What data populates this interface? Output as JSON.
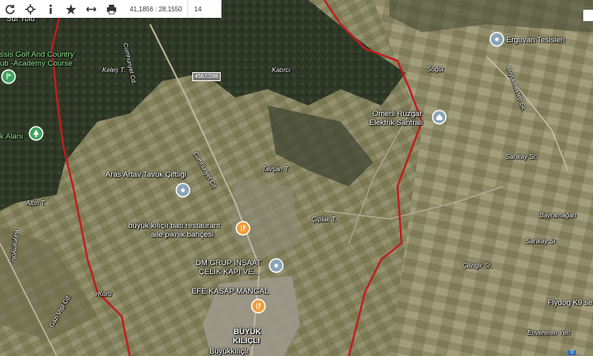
{
  "toolbar": {
    "coords": "41,1856 : 28,1550",
    "zoom": "14"
  },
  "places": {
    "sut_yolu": "Sut Yolu",
    "golf1": "ssis Golf And Country",
    "golf2": "ub -Academy Course",
    "keles": "Keleş T.",
    "road_4567": "4567/298",
    "katirci": "Katırcı",
    "sogut": "Söğüt",
    "erguvan": "Erguvan Tesisleri",
    "omerli1": "Ömerli Rüzgar",
    "omerli2": "Elektrik Santrali",
    "k_alani": "k Alanı",
    "aras": "Aras Artav Tavuk Çiftliği",
    "altin": "Altın T.",
    "tavsan": "Tavşan T.",
    "ciplak": "Çıplak T.",
    "sarikaya": "Sarıkay Sr.",
    "bayramagan": "Bayramağan",
    "sarikaya2": "Sarıkay Sr.",
    "rest1": "büyük kılıçlı batı restaurant",
    "rest2": "aile piknik bahçesi",
    "dm1": "DM GRUP İNŞAAT",
    "dm2": "ÇELİK KAPI VE...",
    "efe": "EFE KASAP MANGAL",
    "cilingir": "Çilingir Sr.",
    "flydog": "Flydog K9 se",
    "koru": "rKoru",
    "envereren": "Envereren Yeri",
    "buyuk1": "BÜYÜK",
    "buyuk2": "KILIÇLI",
    "buyuk3": "Büyükkılıçlı",
    "cumhuriyet1": "Cumhuriyet Cd.",
    "cumhuriyet2": "Cumhuriyet Cd.",
    "buyukmektep": "Büyükmektep Sk.",
    "bayramyolu": "Bayramyolu",
    "gazi": "Gazi Vişil Cd."
  },
  "colors": {
    "boundary": "#c21d1d",
    "forest": "#2f3a26",
    "field": "#7c7a5c"
  },
  "badge": "©"
}
